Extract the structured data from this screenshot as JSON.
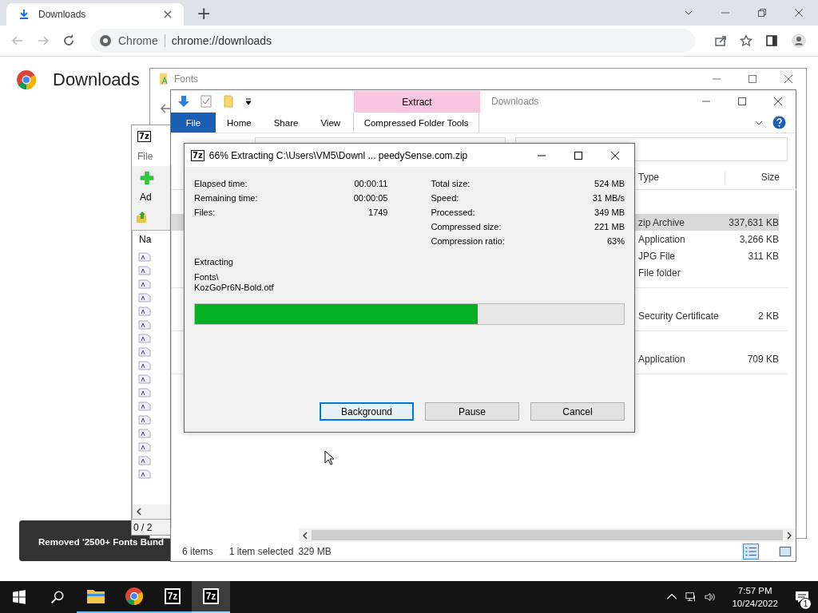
{
  "browser": {
    "tab": {
      "title": "Downloads"
    },
    "new_tab": "+",
    "omnibox": {
      "site": "Chrome",
      "url": "chrome://downloads"
    },
    "page_title": "Downloads",
    "toast": "Removed '2500+ Fonts Bund"
  },
  "fonts_window": {
    "title": "Fonts"
  },
  "sevenzip_window": {
    "logo": "7z",
    "menu": "File",
    "toolbar_label": "Ad",
    "column": "Na",
    "status": "0 / 2"
  },
  "explorer": {
    "title": "Downloads",
    "context_tab": "Extract",
    "tabs": [
      {
        "label": "File",
        "kind": "menu",
        "selected": false
      },
      {
        "label": "Home",
        "kind": "tab",
        "selected": false
      },
      {
        "label": "Share",
        "kind": "tab",
        "selected": false
      },
      {
        "label": "View",
        "kind": "tab",
        "selected": false
      },
      {
        "label": "Compressed Folder Tools",
        "kind": "context",
        "selected": true
      }
    ],
    "columns": [
      "Type",
      "Size"
    ],
    "groups": [
      {
        "rows": [
          {
            "type": "zip Archive",
            "size": "337,631 KB",
            "selected": true
          },
          {
            "type": "Application",
            "size": "3,266 KB",
            "selected": false
          },
          {
            "type": "JPG File",
            "size": "311 KB",
            "selected": false
          },
          {
            "type": "File folder",
            "size": "",
            "selected": false
          }
        ]
      },
      {
        "rows": [
          {
            "type": "Security Certificate",
            "size": "2 KB",
            "selected": false
          }
        ]
      },
      {
        "rows": [
          {
            "type": "Application",
            "size": "709 KB",
            "selected": false
          }
        ]
      }
    ],
    "status": {
      "count": "6 items",
      "selection": "1 item selected",
      "size": "329 MB"
    }
  },
  "dialog": {
    "logo": "7z",
    "title": "66% Extracting C:\\Users\\VM5\\Downl ... peedySense.com.zip",
    "left_stats": [
      {
        "label": "Elapsed time:",
        "value": "00:00:11"
      },
      {
        "label": "Remaining time:",
        "value": "00:00:05"
      },
      {
        "label": "Files:",
        "value": "1749"
      }
    ],
    "right_stats": [
      {
        "label": "Total size:",
        "value": "524 MB"
      },
      {
        "label": "Speed:",
        "value": "31 MB/s"
      },
      {
        "label": "Processed:",
        "value": "349 MB"
      },
      {
        "label": "Compressed size:",
        "value": "221 MB"
      },
      {
        "label": "Compression ratio:",
        "value": "63%"
      }
    ],
    "action": "Extracting",
    "folder": "Fonts\\",
    "file": "KozGoPr6N-Bold.otf",
    "progress": {
      "level": 0.66
    },
    "buttons": [
      {
        "label": "Background",
        "focused": true
      },
      {
        "label": "Pause",
        "focused": false
      },
      {
        "label": "Cancel",
        "focused": false
      }
    ]
  },
  "taskbar": {
    "apps": [
      {
        "kind": "explorer",
        "selected": false
      },
      {
        "kind": "chrome",
        "selected": false
      },
      {
        "kind": "sevenzip",
        "label": "7z",
        "selected": false
      },
      {
        "kind": "sevenzip",
        "label": "7z",
        "selected": true
      }
    ],
    "time": "7:57 PM",
    "date": "10/24/2022",
    "notifications": "1"
  }
}
